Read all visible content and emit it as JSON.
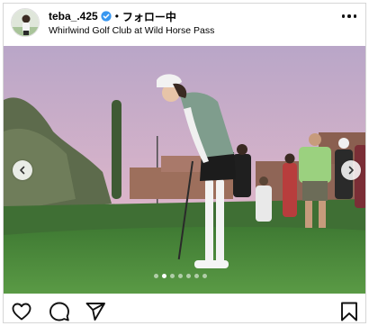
{
  "post": {
    "username": "teba_.425",
    "separator": "•",
    "follow_label": "フォロー中",
    "location": "Whirlwind Golf Club at Wild Horse Pass"
  },
  "carousel": {
    "slide_count": 7,
    "active_index": 1
  },
  "icons": {
    "verified": "verified-badge-icon",
    "more": "more-options-icon",
    "prev": "chevron-left-icon",
    "next": "chevron-right-icon",
    "like": "heart-icon",
    "comment": "comment-bubble-icon",
    "share": "paper-plane-icon",
    "save": "bookmark-icon"
  },
  "colors": {
    "verified": "#3897f0",
    "sky_top": "#b9a6c8",
    "sky_bottom": "#e7b7c8",
    "green": "#4f8a3a"
  }
}
